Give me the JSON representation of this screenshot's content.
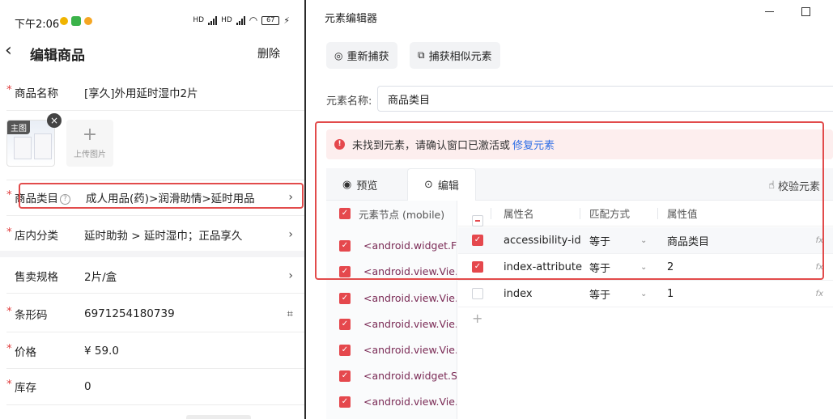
{
  "phone": {
    "status": {
      "time": "下午2:06",
      "network_label": "HD",
      "battery": "67"
    },
    "header": {
      "title": "编辑商品",
      "delete_label": "删除"
    },
    "product_name": {
      "label": "商品名称",
      "value": "[享久]外用延时湿巾2片"
    },
    "images": {
      "main_tag": "主图",
      "upload_label": "上传图片"
    },
    "category": {
      "label": "商品类目",
      "value": "成人用品(药)>润滑助情>延时用品"
    },
    "store_category": {
      "label": "店内分类",
      "value": "延时助勃 > 延时湿巾；正品享久"
    },
    "spec": {
      "label": "售卖规格",
      "value": "2片/盒"
    },
    "barcode": {
      "label": "条形码",
      "value": "6971254180739"
    },
    "price": {
      "label": "价格",
      "value": "¥ 59.0"
    },
    "stock": {
      "label": "库存",
      "value": "0"
    }
  },
  "editor": {
    "window_title": "元素编辑器",
    "toolbar": {
      "recapture": "重新捕获",
      "capture_similar": "捕获相似元素"
    },
    "element_name": {
      "label": "元素名称:",
      "value": "商品类目"
    },
    "alert": {
      "message": "未找到元素，请确认窗口已激活或",
      "link": "修复元素"
    },
    "tabs": {
      "preview": "预览",
      "edit": "编辑",
      "verify": "校验元素"
    },
    "tree": {
      "header": "元素节点 (mobile)",
      "items": [
        "<android.widget.F…",
        "<android.view.Vie…",
        "<android.view.Vie…",
        "<android.view.Vie…",
        "<android.view.Vie…",
        "<android.widget.S…",
        "<android.view.Vie…"
      ]
    },
    "attributes": {
      "headers": {
        "name": "属性名",
        "match": "匹配方式",
        "value": "属性值"
      },
      "rows": [
        {
          "name": "accessibility-id",
          "match": "等于",
          "value": "商品类目",
          "checked": true
        },
        {
          "name": "index-attribute",
          "match": "等于",
          "value": "2",
          "checked": true
        },
        {
          "name": "index",
          "match": "等于",
          "value": "1",
          "checked": false
        }
      ],
      "fx_label": "fx",
      "add_label": "+"
    }
  },
  "colors": {
    "accent_red": "#e5484d",
    "link_blue": "#2f6ee5",
    "highlight_box": "#e24b4b"
  }
}
